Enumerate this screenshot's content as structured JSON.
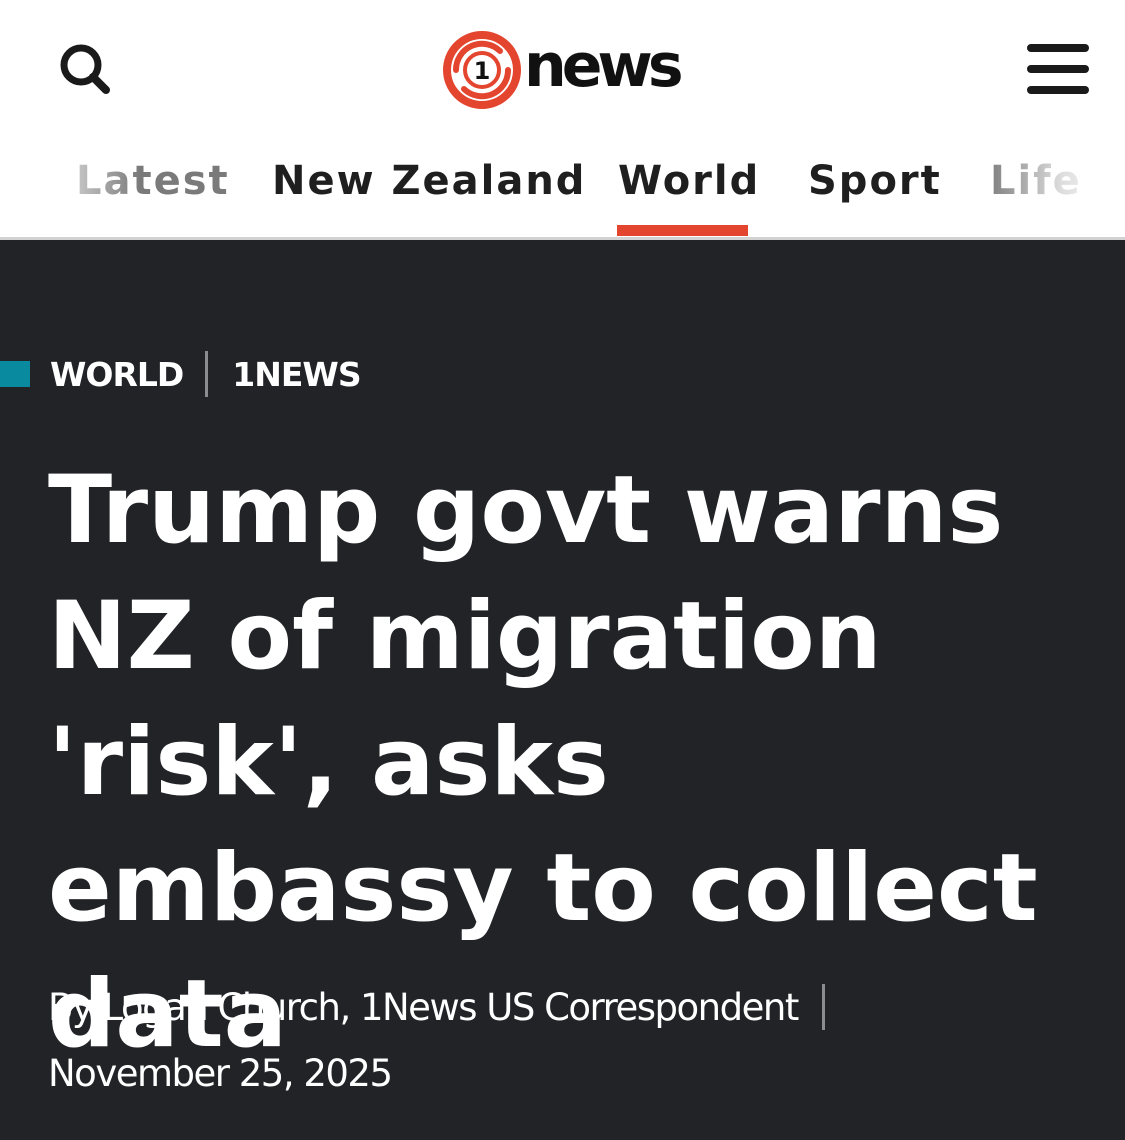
{
  "header": {
    "search_icon": "search-icon",
    "logo_text": "news",
    "logo_mark_text": "1",
    "menu_icon": "hamburger-menu-icon"
  },
  "nav": {
    "items": [
      {
        "label": "Latest"
      },
      {
        "label": "New Zealand"
      },
      {
        "label": "World",
        "active": true
      },
      {
        "label": "Sport"
      },
      {
        "label": "Life"
      }
    ],
    "active_color": "#e4452e"
  },
  "article": {
    "section": "WORLD",
    "source": "1NEWS",
    "headline": "Trump govt warns NZ of migration 'risk', asks embassy to collect data",
    "byline": "By Logan Church, 1News US Correspondent",
    "date": "November 25, 2025"
  },
  "colors": {
    "hero_background": "#212327",
    "kicker_accent": "#0a8a9e",
    "brand_red": "#e4452e"
  }
}
